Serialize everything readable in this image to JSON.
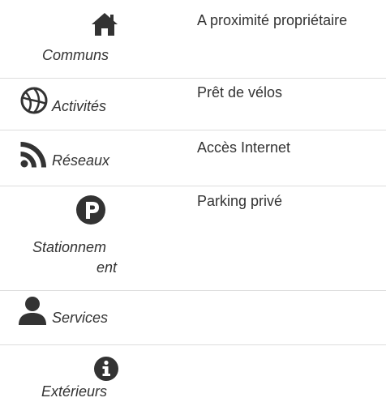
{
  "amenities": [
    {
      "category": "Communs",
      "icon": "home-icon",
      "value": "A proximité propriétaire"
    },
    {
      "category": "Activités",
      "icon": "basketball-icon",
      "value": "Prêt de vélos"
    },
    {
      "category": "Réseaux",
      "icon": "rss-icon",
      "value": "Accès Internet"
    },
    {
      "category_line1": "Stationnem",
      "category_line2": "ent",
      "icon": "parking-icon",
      "value": "Parking privé"
    },
    {
      "category": "Services",
      "icon": "user-icon",
      "value": ""
    },
    {
      "category": "Extérieurs",
      "icon": "info-icon",
      "value": ""
    }
  ]
}
